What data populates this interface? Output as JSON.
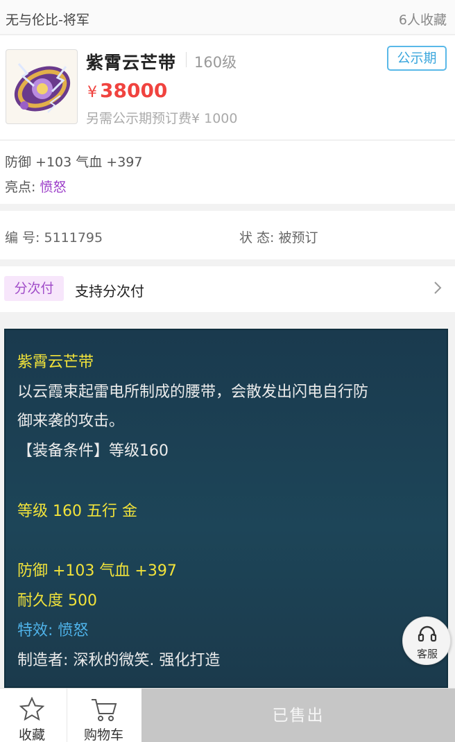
{
  "topbar": {
    "server": "无与伦比-将军",
    "fav_count": "6人收藏"
  },
  "item": {
    "name": "紫霄云芒带",
    "level": "160级",
    "badge": "公示期",
    "price_symbol": "¥",
    "price": "38000",
    "deposit": "另需公示期预订费¥ 1000"
  },
  "attrs": {
    "line": "防御 +103 气血 +397",
    "highlight_label": "亮点:",
    "highlight_value": "愤怒"
  },
  "info": {
    "id": "编 号:  5111795",
    "status": "状 态:  被预订"
  },
  "payment": {
    "tag": "分次付",
    "text": "支持分次付"
  },
  "description": {
    "title": "紫霄云芒带",
    "text_line1": "以云霞束起雷电所制成的腰带，会散发出闪电自行防",
    "text_line2": "御来袭的攻击。",
    "requirement": "【装备条件】等级160",
    "level_element": "等级 160 五行 金",
    "stats": "防御 +103 气血 +397",
    "durability": "耐久度 500",
    "effect": "特效:  愤怒",
    "maker": "制造者:  深秋的微笑.  强化打造"
  },
  "service": {
    "label": "客服",
    "icon": "headset-icon"
  },
  "bottom": {
    "fav_label": "收藏",
    "cart_label": "购物车",
    "sold_label": "已售出"
  },
  "colors": {
    "price": "#f0433f",
    "badge": "#3aa6dd",
    "purple": "#9b3cc8",
    "desc_yellow": "#f2e33a",
    "desc_blue": "#4fb3ea",
    "desc_bg": "#1d4558"
  }
}
